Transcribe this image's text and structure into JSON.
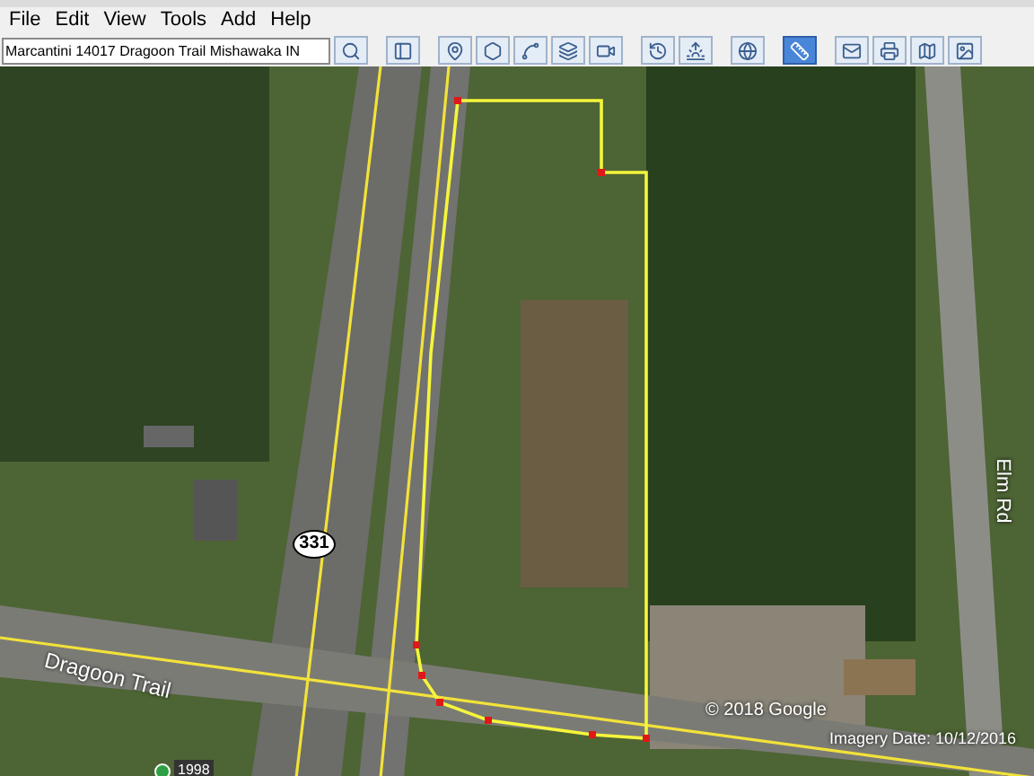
{
  "menu": [
    {
      "label": "File"
    },
    {
      "label": "Edit"
    },
    {
      "label": "View"
    },
    {
      "label": "Tools"
    },
    {
      "label": "Add"
    },
    {
      "label": "Help"
    }
  ],
  "search": {
    "value": "Marcantini 14017 Dragoon Trail Mishawaka IN"
  },
  "toolbar": [
    {
      "kind": "search",
      "selected": false
    },
    {
      "kind": "sidebar",
      "selected": false
    },
    {
      "kind": "placemark",
      "selected": false
    },
    {
      "kind": "polygon",
      "selected": false
    },
    {
      "kind": "path",
      "selected": false
    },
    {
      "kind": "overlay",
      "selected": false
    },
    {
      "kind": "tour",
      "selected": false
    },
    {
      "kind": "history",
      "selected": false
    },
    {
      "kind": "sun",
      "selected": false
    },
    {
      "kind": "planet",
      "selected": false
    },
    {
      "kind": "ruler",
      "selected": true
    },
    {
      "kind": "email",
      "selected": false
    },
    {
      "kind": "print",
      "selected": false
    },
    {
      "kind": "maps",
      "selected": false
    },
    {
      "kind": "image",
      "selected": false
    }
  ],
  "map": {
    "route_shield": "331",
    "street_labels": [
      {
        "kind": "horizontal",
        "text": "Dragoon Trail"
      },
      {
        "kind": "vertical",
        "text": "Elm Rd"
      }
    ],
    "copyright": "© 2018 Google",
    "history_year": "1998",
    "imagery_date": "Imagery Date: 10/12/2016"
  }
}
